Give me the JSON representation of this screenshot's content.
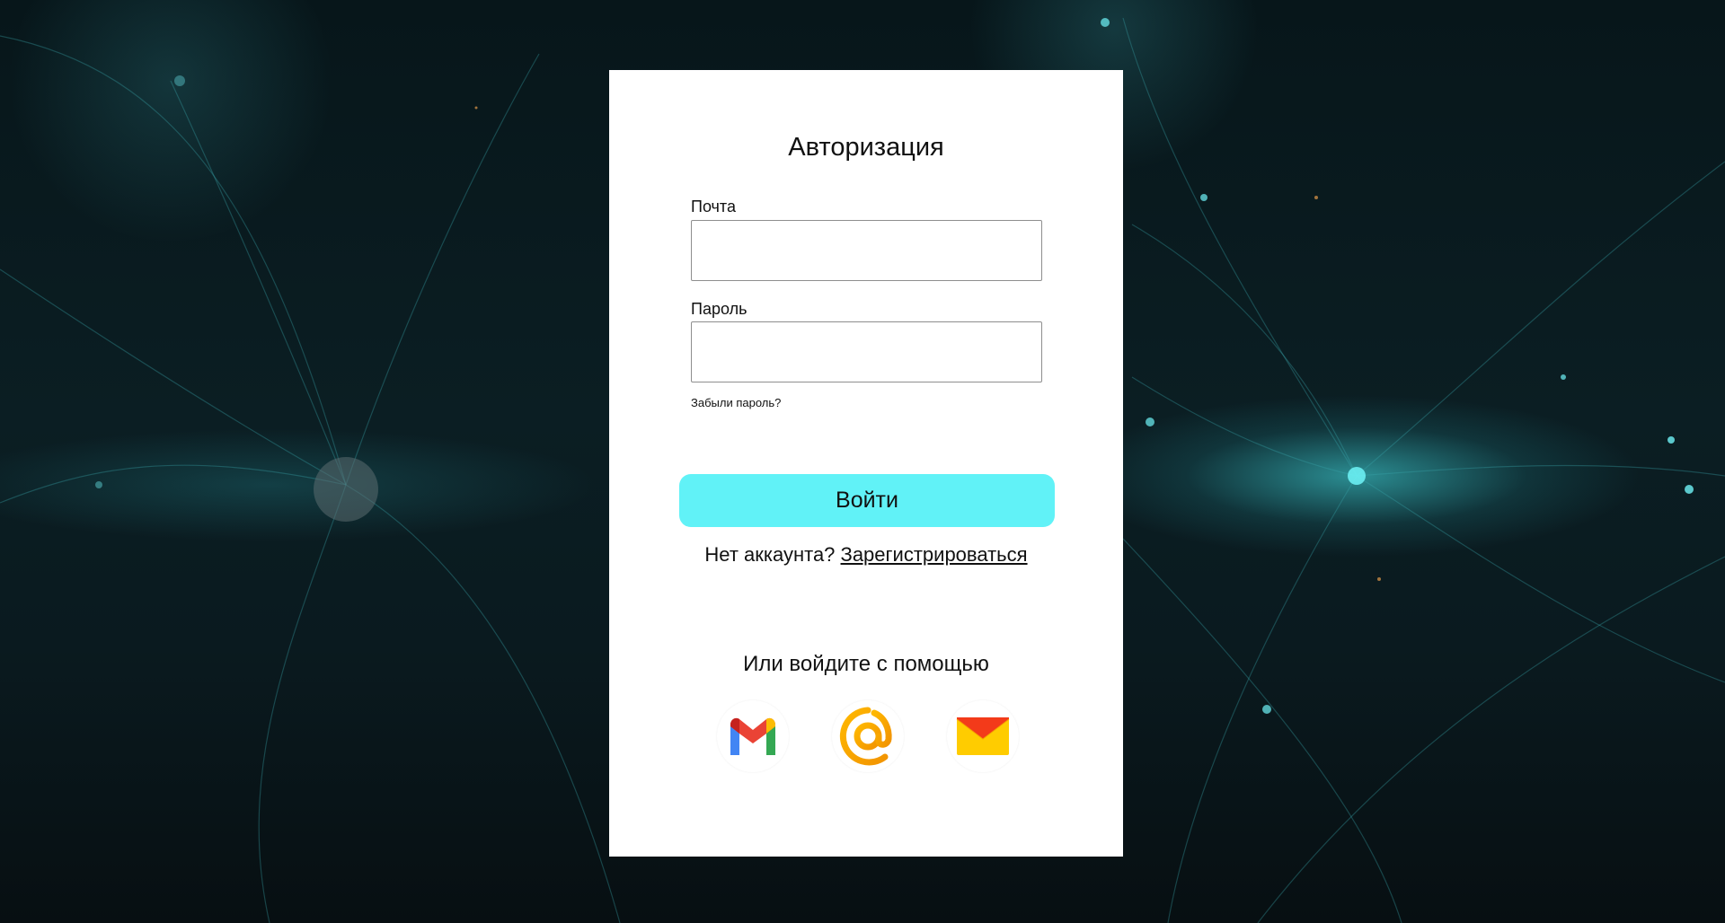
{
  "auth": {
    "title": "Авторизация",
    "email_label": "Почта",
    "email_value": "",
    "password_label": "Пароль",
    "password_value": "",
    "forgot_link": "Забыли пароль?",
    "login_button": "Войти",
    "no_account_text": "Нет аккаунта? ",
    "register_link": "Зарегистрироваться",
    "alt_title": "Или войдите с помощью"
  },
  "providers": [
    {
      "icon": "gmail-icon"
    },
    {
      "icon": "mailru-icon"
    },
    {
      "icon": "yandex-mail-icon"
    }
  ],
  "colors": {
    "accent": "#61f2f7",
    "card_bg": "#ffffff",
    "page_bg": "#0a1a1f"
  }
}
